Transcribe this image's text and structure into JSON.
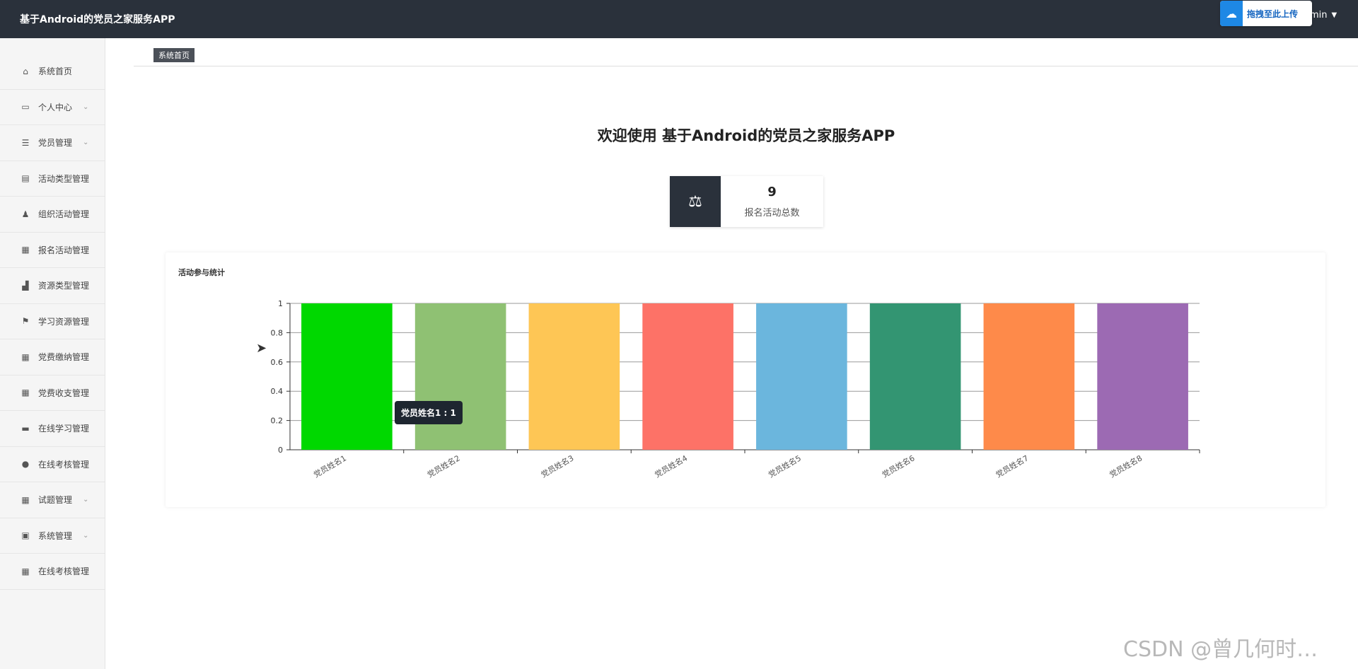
{
  "header": {
    "app_title": "基于Android的党员之家服务APP",
    "upload_label": "拖拽至此上传",
    "upload_icon": "cloud-icon",
    "user_label": "min",
    "user_caret": "▼"
  },
  "sidebar": {
    "items": [
      {
        "label": "系统首页",
        "icon": "⌂",
        "arrow": ""
      },
      {
        "label": "个人中心",
        "icon": "▭",
        "arrow": "⌄"
      },
      {
        "label": "党员管理",
        "icon": "☰",
        "arrow": "⌄"
      },
      {
        "label": "活动类型管理",
        "icon": "▤",
        "arrow": ""
      },
      {
        "label": "组织活动管理",
        "icon": "♟",
        "arrow": ""
      },
      {
        "label": "报名活动管理",
        "icon": "▦",
        "arrow": ""
      },
      {
        "label": "资源类型管理",
        "icon": "▟",
        "arrow": ""
      },
      {
        "label": "学习资源管理",
        "icon": "⚑",
        "arrow": ""
      },
      {
        "label": "党费缴纳管理",
        "icon": "▦",
        "arrow": ""
      },
      {
        "label": "党费收支管理",
        "icon": "▦",
        "arrow": ""
      },
      {
        "label": "在线学习管理",
        "icon": "▬",
        "arrow": ""
      },
      {
        "label": "在线考核管理",
        "icon": "●",
        "arrow": ""
      },
      {
        "label": "试题管理",
        "icon": "▦",
        "arrow": "⌄"
      },
      {
        "label": "系统管理",
        "icon": "▣",
        "arrow": "⌄"
      },
      {
        "label": "在线考核管理",
        "icon": "▦",
        "arrow": ""
      }
    ]
  },
  "breadcrumb": {
    "label": "系统首页"
  },
  "main": {
    "welcome": "欢迎使用 基于Android的党员之家服务APP",
    "stat": {
      "value": "9",
      "label": "报名活动总数",
      "icon": "⚖"
    },
    "chart_title": "活动参与统计",
    "tooltip": "党员姓名1 : 1"
  },
  "watermark": "CSDN @曾几何时…",
  "chart_data": {
    "type": "bar",
    "title": "活动参与统计",
    "categories": [
      "党员姓名1",
      "党员姓名2",
      "党员姓名3",
      "党员姓名4",
      "党员姓名5",
      "党员姓名6",
      "党员姓名7",
      "党员姓名8"
    ],
    "values": [
      1,
      1,
      1,
      1,
      1,
      1,
      1,
      1
    ],
    "colors": [
      "#00d800",
      "#8fc173",
      "#fec655",
      "#fd7267",
      "#6bb6dd",
      "#339572",
      "#fe8a4a",
      "#9c6ab3"
    ],
    "yticks": [
      "0",
      "0.2",
      "0.4",
      "0.6",
      "0.8",
      "1"
    ],
    "ylim": [
      0,
      1
    ],
    "grid": true,
    "xlabel": "",
    "ylabel": ""
  }
}
